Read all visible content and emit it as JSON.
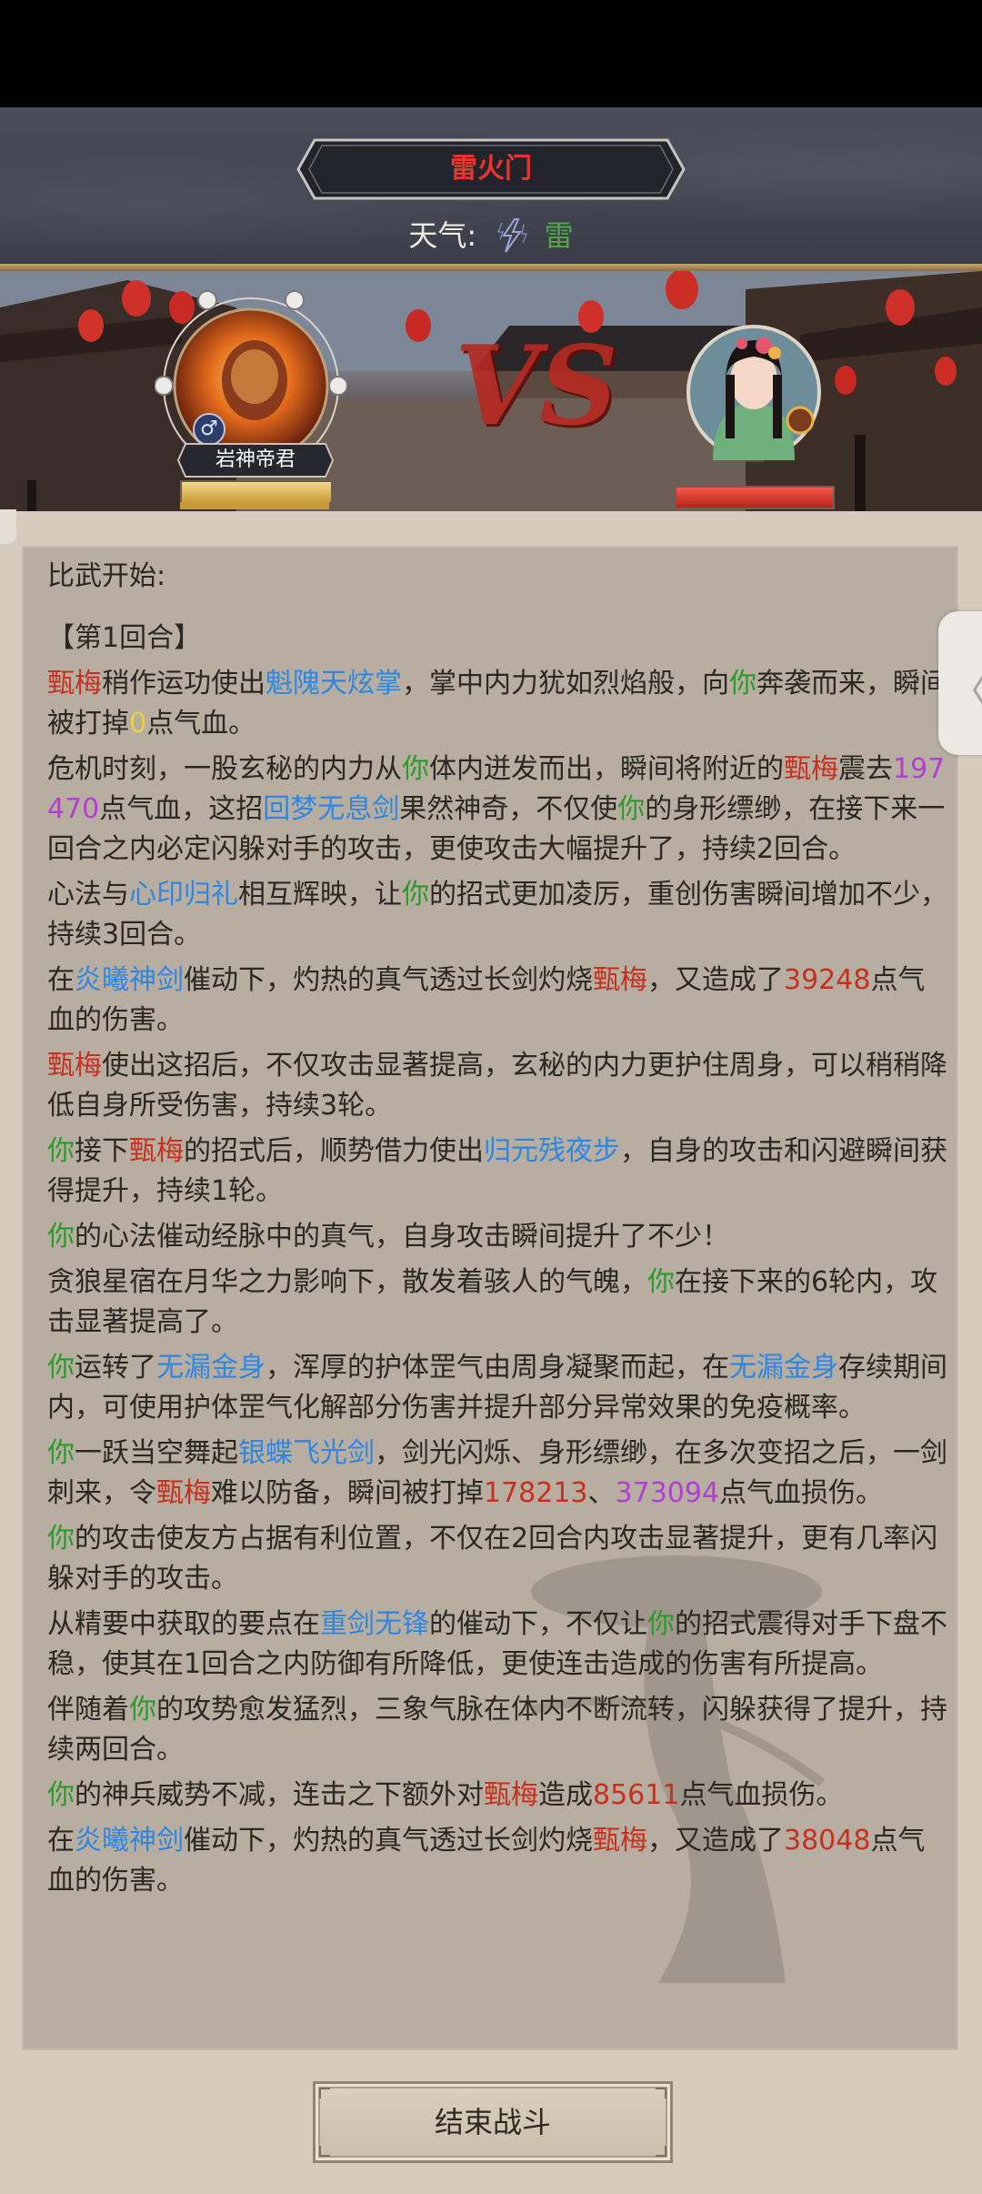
{
  "header": {
    "title": "雷火门",
    "weather_label": "天气:",
    "weather_icon": "lightning-icon",
    "weather_value": "雷"
  },
  "battle": {
    "player_name": "岩神帝君",
    "player_gender_icon": "male-icon",
    "player_hp_fraction": 1.0,
    "enemy_hp_fraction": 1.0,
    "vs_text": "VS"
  },
  "log": [
    {
      "segs": [
        {
          "t": "比武开始:",
          "c": ""
        }
      ],
      "cls": "hdr"
    },
    {
      "segs": [
        {
          "t": "【第1回合】",
          "c": ""
        }
      ]
    },
    {
      "segs": [
        {
          "t": "甄梅",
          "c": "r"
        },
        {
          "t": "稍作运功使出",
          "c": ""
        },
        {
          "t": "魁隗天炫掌",
          "c": "b"
        },
        {
          "t": "，掌中内力犹如烈焰般，向",
          "c": ""
        },
        {
          "t": "你",
          "c": "g"
        },
        {
          "t": "奔袭而来，瞬间被打掉",
          "c": ""
        },
        {
          "t": "0",
          "c": "y"
        },
        {
          "t": "点气血。",
          "c": ""
        }
      ]
    },
    {
      "segs": [
        {
          "t": "危机时刻，一股玄秘的内力从",
          "c": ""
        },
        {
          "t": "你",
          "c": "g"
        },
        {
          "t": "体内迸发而出，瞬间将附近的",
          "c": ""
        },
        {
          "t": "甄梅",
          "c": "r"
        },
        {
          "t": "震去",
          "c": ""
        },
        {
          "t": "197470",
          "c": "p"
        },
        {
          "t": "点气血，这招",
          "c": ""
        },
        {
          "t": "回梦无息剑",
          "c": "b"
        },
        {
          "t": "果然神奇，不仅使",
          "c": ""
        },
        {
          "t": "你",
          "c": "g"
        },
        {
          "t": "的身形缥缈，在接下来一回合之内必定闪躲对手的攻击，更使攻击大幅提升了，持续2回合。",
          "c": ""
        }
      ]
    },
    {
      "segs": [
        {
          "t": "心法与",
          "c": ""
        },
        {
          "t": "心印归礼",
          "c": "b"
        },
        {
          "t": "相互辉映，让",
          "c": ""
        },
        {
          "t": "你",
          "c": "g"
        },
        {
          "t": "的招式更加凌厉，重创伤害瞬间增加不少，持续3回合。",
          "c": ""
        }
      ]
    },
    {
      "segs": [
        {
          "t": "在",
          "c": ""
        },
        {
          "t": "炎曦神剑",
          "c": "b"
        },
        {
          "t": "催动下，灼热的真气透过长剑灼烧",
          "c": ""
        },
        {
          "t": "甄梅",
          "c": "r"
        },
        {
          "t": "，又造成了",
          "c": ""
        },
        {
          "t": "39248",
          "c": "r"
        },
        {
          "t": "点气血的伤害。",
          "c": ""
        }
      ]
    },
    {
      "segs": [
        {
          "t": "甄梅",
          "c": "r"
        },
        {
          "t": "使出这招后，不仅攻击显著提高，玄秘的内力更护住周身，可以稍稍降低自身所受伤害，持续3轮。",
          "c": ""
        }
      ]
    },
    {
      "segs": [
        {
          "t": "你",
          "c": "g"
        },
        {
          "t": "接下",
          "c": ""
        },
        {
          "t": "甄梅",
          "c": "r"
        },
        {
          "t": "的招式后，顺势借力使出",
          "c": ""
        },
        {
          "t": "归元残夜步",
          "c": "b"
        },
        {
          "t": "，自身的攻击和闪避瞬间获得提升，持续1轮。",
          "c": ""
        }
      ]
    },
    {
      "segs": [
        {
          "t": "你",
          "c": "g"
        },
        {
          "t": "的心法催动经脉中的真气，自身攻击瞬间提升了不少！",
          "c": ""
        }
      ]
    },
    {
      "segs": [
        {
          "t": "贪狼星宿在月华之力影响下，散发着骇人的气魄，",
          "c": ""
        },
        {
          "t": "你",
          "c": "g"
        },
        {
          "t": "在接下来的6轮内，攻击显著提高了。",
          "c": ""
        }
      ]
    },
    {
      "segs": [
        {
          "t": "你",
          "c": "g"
        },
        {
          "t": "运转了",
          "c": ""
        },
        {
          "t": "无漏金身",
          "c": "b"
        },
        {
          "t": "，浑厚的护体罡气由周身凝聚而起，在",
          "c": ""
        },
        {
          "t": "无漏金身",
          "c": "b"
        },
        {
          "t": "存续期间内，可使用护体罡气化解部分伤害并提升部分异常效果的免疫概率。",
          "c": ""
        }
      ]
    },
    {
      "segs": [
        {
          "t": "你",
          "c": "g"
        },
        {
          "t": "一跃当空舞起",
          "c": ""
        },
        {
          "t": "银蝶飞光剑",
          "c": "b"
        },
        {
          "t": "，剑光闪烁、身形缥缈，在多次变招之后，一剑刺来，令",
          "c": ""
        },
        {
          "t": "甄梅",
          "c": "r"
        },
        {
          "t": "难以防备，瞬间被打掉",
          "c": ""
        },
        {
          "t": "178213",
          "c": "r"
        },
        {
          "t": "、",
          "c": ""
        },
        {
          "t": "373094",
          "c": "p"
        },
        {
          "t": "点气血损伤。",
          "c": ""
        }
      ]
    },
    {
      "segs": [
        {
          "t": "你",
          "c": "g"
        },
        {
          "t": "的攻击使友方占据有利位置，不仅在2回合内攻击显著提升，更有几率闪躲对手的攻击。",
          "c": ""
        }
      ]
    },
    {
      "segs": [
        {
          "t": "从精要中获取的要点在",
          "c": ""
        },
        {
          "t": "重剑无锋",
          "c": "b"
        },
        {
          "t": "的催动下，不仅让",
          "c": ""
        },
        {
          "t": "你",
          "c": "g"
        },
        {
          "t": "的招式震得对手下盘不稳，使其在1回合之内防御有所降低，更使连击造成的伤害有所提高。",
          "c": ""
        }
      ]
    },
    {
      "segs": [
        {
          "t": "伴随着",
          "c": ""
        },
        {
          "t": "你",
          "c": "g"
        },
        {
          "t": "的攻势愈发猛烈，三象气脉在体内不断流转，闪躲获得了提升，持续两回合。",
          "c": ""
        }
      ]
    },
    {
      "segs": [
        {
          "t": "你",
          "c": "g"
        },
        {
          "t": "的神兵威势不减，连击之下额外对",
          "c": ""
        },
        {
          "t": "甄梅",
          "c": "r"
        },
        {
          "t": "造成",
          "c": ""
        },
        {
          "t": "85611",
          "c": "r"
        },
        {
          "t": "点气血损伤。",
          "c": ""
        }
      ]
    },
    {
      "segs": [
        {
          "t": "在",
          "c": ""
        },
        {
          "t": "炎曦神剑",
          "c": "b"
        },
        {
          "t": "催动下，灼热的真气透过长剑灼烧",
          "c": ""
        },
        {
          "t": "甄梅",
          "c": "r"
        },
        {
          "t": "，又造成了",
          "c": ""
        },
        {
          "t": "38048",
          "c": "r"
        },
        {
          "t": "点气血的伤害。",
          "c": ""
        }
      ]
    }
  ],
  "footer": {
    "end_button": "结束战斗"
  },
  "side_tab_icon": "chevron-left-icon",
  "colors": {
    "enemy_name": "#c5301f",
    "player_you": "#2c9a2a",
    "skill": "#2f86e0",
    "crit_damage": "#b23fd2",
    "zero": "#e8d04a",
    "title": "#e8352e"
  }
}
